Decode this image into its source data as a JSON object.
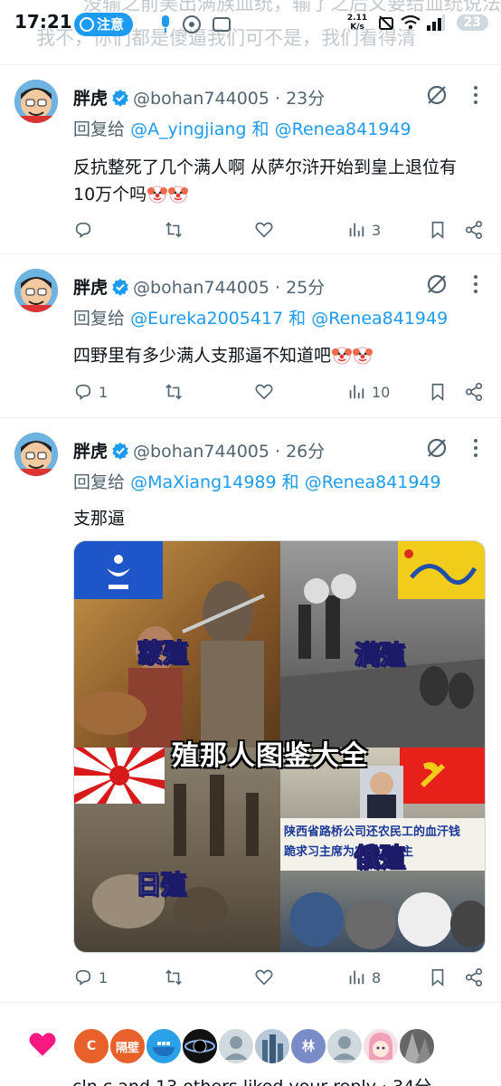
{
  "status_bar": {
    "time": "17:21",
    "notice_label": "注意",
    "speed_value": "2.11",
    "speed_unit": "K/s",
    "battery": "23",
    "ghost_line1": "没输之前美出满族血统，输了之后又要给血统说法",
    "ghost_line2": "我不，你们都是傻逼我们可不是，我们看得清"
  },
  "tweets": [
    {
      "name": "胖虎",
      "handle": "@bohan744005",
      "time": "23分",
      "reply_prefix": "回复给",
      "reply_to_1": "@A_yingjiang",
      "reply_and": "和",
      "reply_to_2": "@Renea841949",
      "text_line1": "反抗整死了几个满人啊 从萨尔浒开始到皇上退位有",
      "text_line2": "10万个吗",
      "replies": "",
      "views": "3"
    },
    {
      "name": "胖虎",
      "handle": "@bohan744005",
      "time": "25分",
      "reply_prefix": "回复给",
      "reply_to_1": "@Eureka2005417",
      "reply_and": "和",
      "reply_to_2": "@Renea841949",
      "text_line1": "四野里有多少满人支那逼不知道吧",
      "replies": "1",
      "views": "10"
    },
    {
      "name": "胖虎",
      "handle": "@bohan744005",
      "time": "26分",
      "reply_prefix": "回复给",
      "reply_to_1": "@MaXiang14989",
      "reply_and": "和",
      "reply_to_2": "@Renea841949",
      "text_line1": "支那逼",
      "replies": "1",
      "views": "8",
      "media": {
        "title": "殖那人图鉴大全",
        "label_tl": "蒙殖",
        "label_tr": "满殖",
        "label_bl": "日殖",
        "label_br": "俄殖",
        "banner_line1": "陕西省路桥公司还农民工的血汗钱",
        "banner_line2": "跪求习主席为农民工做主"
      }
    }
  ],
  "liked": {
    "avatar_letters": [
      "C",
      "隔壁",
      "林"
    ],
    "text": "cln.c and 13 others liked your reply · 34分"
  },
  "colors": {
    "accent": "#1d9bf0",
    "text": "#0f1419",
    "secondary": "#536471",
    "heart": "#f91880"
  }
}
